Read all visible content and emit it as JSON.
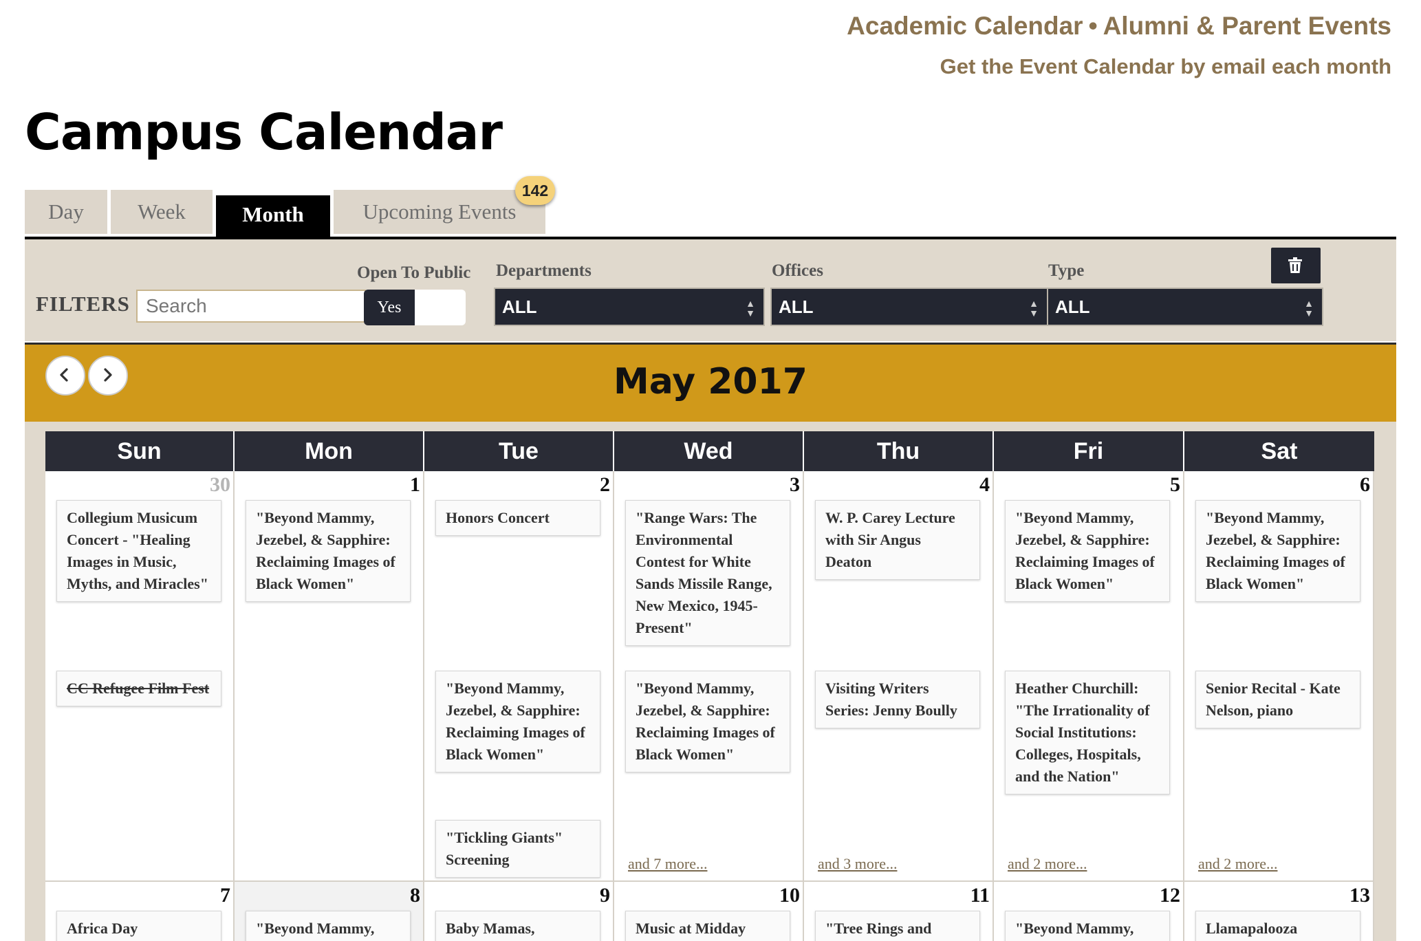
{
  "header": {
    "links_row1": [
      "Academic Calendar",
      "Alumni & Parent Events"
    ],
    "separator": "•",
    "link_row2": "Get the Event Calendar by email each month",
    "title": "Campus Calendar"
  },
  "tabs": [
    {
      "label": "Day",
      "active": false
    },
    {
      "label": "Week",
      "active": false
    },
    {
      "label": "Month",
      "active": true
    },
    {
      "label": "Upcoming Events",
      "active": false,
      "badge": "142"
    }
  ],
  "filters": {
    "label": "FILTERS",
    "search_placeholder": "Search",
    "open_to_public": {
      "label": "Open To Public",
      "value": "Yes"
    },
    "departments": {
      "label": "Departments",
      "value": "ALL"
    },
    "offices": {
      "label": "Offices",
      "value": "ALL"
    },
    "type": {
      "label": "Type",
      "value": "ALL"
    },
    "clear_icon": "trash-icon"
  },
  "month": {
    "title": "May 2017",
    "prev_icon": "chevron-left-icon",
    "next_icon": "chevron-right-icon"
  },
  "weekdays": [
    "Sun",
    "Mon",
    "Tue",
    "Wed",
    "Thu",
    "Fri",
    "Sat"
  ],
  "weeks": [
    [
      {
        "day": "30",
        "other_month": true,
        "events": [
          {
            "title": "Collegium Musicum Concert - \"Healing Images in Music, Myths, and Miracles\""
          },
          {
            "title": "CC Refugee Film Fest",
            "cancelled": true
          }
        ],
        "more": ""
      },
      {
        "day": "1",
        "events": [
          {
            "title": "\"Beyond Mammy, Jezebel, & Sapphire: Reclaiming Images of Black Women\""
          }
        ],
        "more": ""
      },
      {
        "day": "2",
        "events": [
          {
            "title": "Honors Concert"
          },
          {
            "title": "\"Beyond Mammy, Jezebel, & Sapphire: Reclaiming Images of Black Women\""
          },
          {
            "title": "\"Tickling Giants\" Screening"
          }
        ],
        "more": ""
      },
      {
        "day": "3",
        "events": [
          {
            "title": "\"Range Wars: The Environmental Contest for White Sands Missile Range, New Mexico, 1945-Present\""
          },
          {
            "title": "\"Beyond Mammy, Jezebel, & Sapphire: Reclaiming Images of Black Women\""
          }
        ],
        "more": "and 7 more..."
      },
      {
        "day": "4",
        "events": [
          {
            "title": "W. P. Carey Lecture with Sir Angus Deaton"
          },
          {
            "title": "Visiting Writers Series: Jenny Boully"
          }
        ],
        "more": "and 3 more..."
      },
      {
        "day": "5",
        "events": [
          {
            "title": "\"Beyond Mammy, Jezebel, & Sapphire: Reclaiming Images of Black Women\""
          },
          {
            "title": "Heather Churchill: \"The Irrationality of Social Institutions: Colleges, Hospitals, and the Nation\""
          }
        ],
        "more": "and 2 more..."
      },
      {
        "day": "6",
        "events": [
          {
            "title": "\"Beyond Mammy, Jezebel, & Sapphire: Reclaiming Images of Black Women\""
          },
          {
            "title": "Senior Recital - Kate Nelson, piano"
          }
        ],
        "more": "and 2 more..."
      }
    ],
    [
      {
        "day": "7",
        "events": [
          {
            "title": "Africa Day"
          }
        ]
      },
      {
        "day": "8",
        "today": true,
        "events": [
          {
            "title": "\"Beyond Mammy,"
          }
        ]
      },
      {
        "day": "9",
        "events": [
          {
            "title": "Baby Mamas,"
          }
        ]
      },
      {
        "day": "10",
        "events": [
          {
            "title": "Music at Midday"
          }
        ]
      },
      {
        "day": "11",
        "events": [
          {
            "title": "\"Tree Rings and"
          }
        ]
      },
      {
        "day": "12",
        "events": [
          {
            "title": "\"Beyond Mammy,"
          }
        ]
      },
      {
        "day": "13",
        "events": [
          {
            "title": "Llamapalooza"
          }
        ]
      }
    ]
  ]
}
